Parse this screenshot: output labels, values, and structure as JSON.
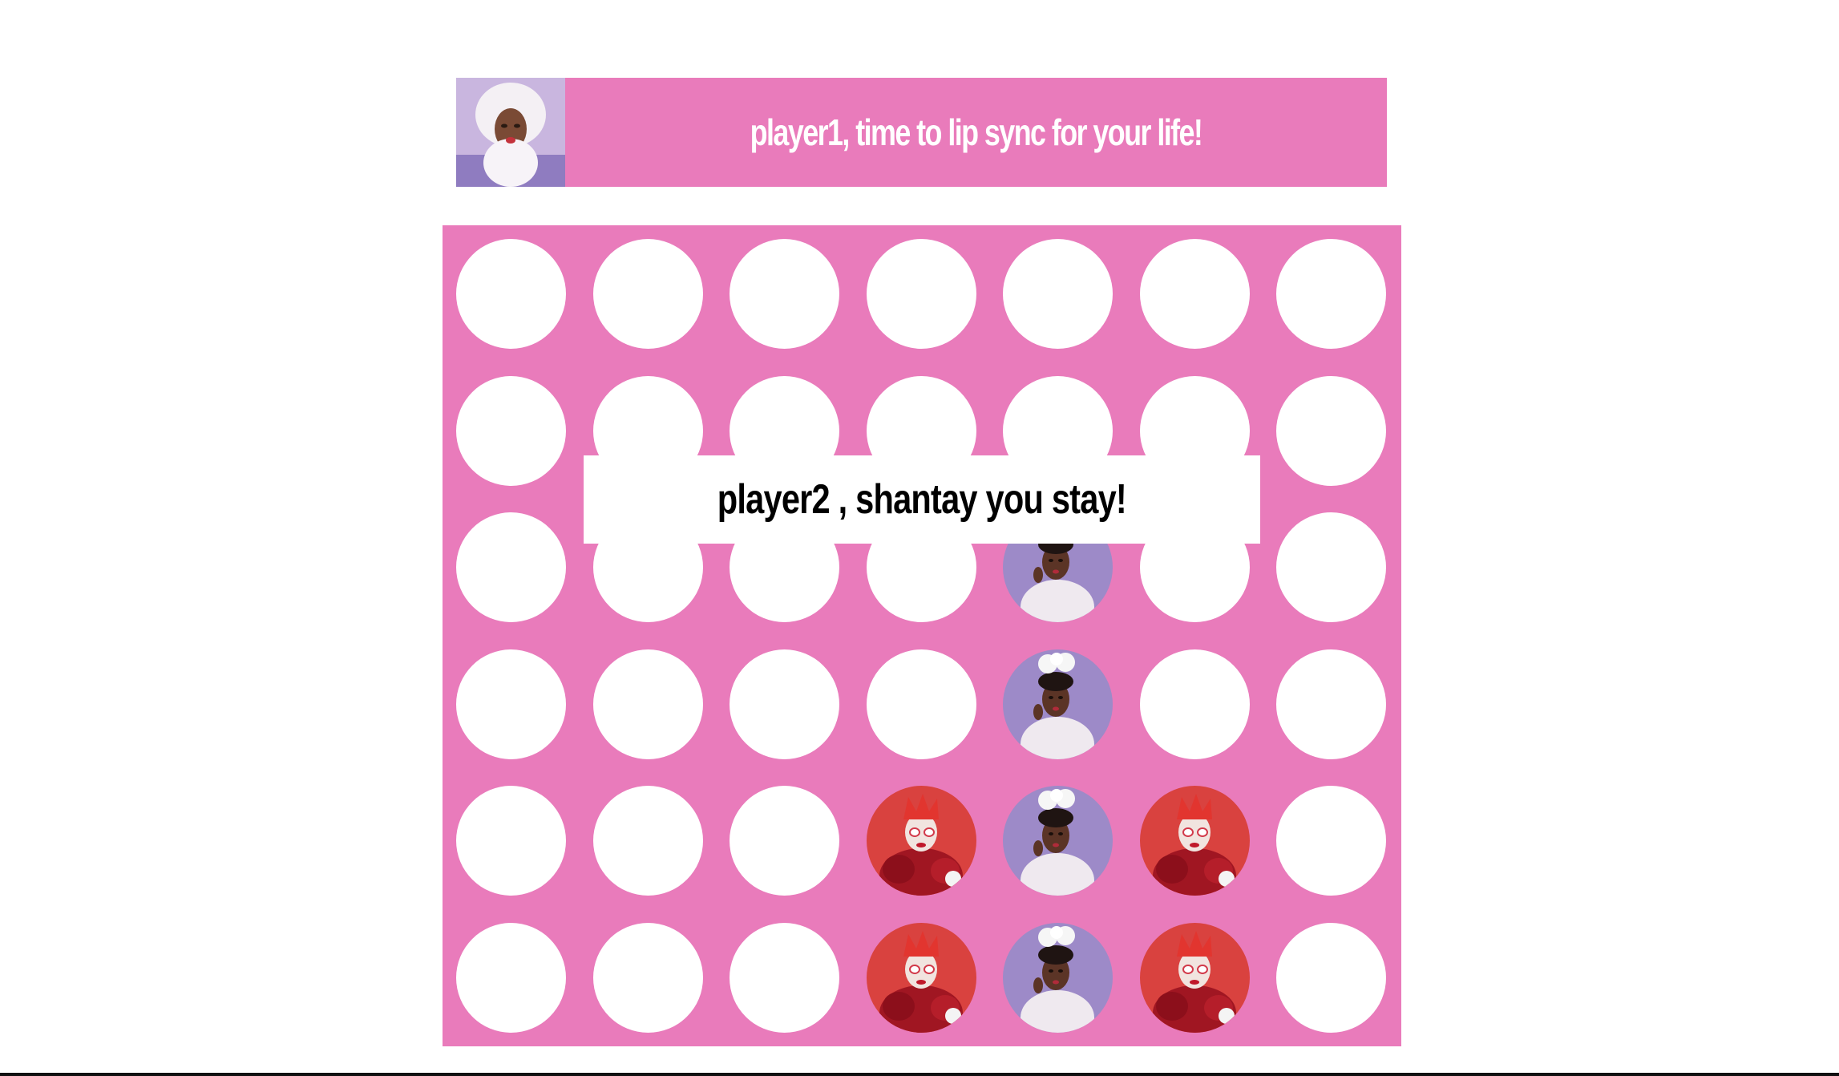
{
  "header": {
    "turn_message": "player1, time to lip sync for your life!",
    "avatar_icon": "player1-queen-avatar-icon"
  },
  "popup": {
    "message": "player2 , shantay you stay!"
  },
  "colors": {
    "board": "#e97bbb",
    "empty_slot": "#ffffff",
    "player1_token_bg": "#d9423f",
    "player2_token_bg": "#9d8ac8"
  },
  "board": {
    "rows": 6,
    "cols": 7,
    "cells": [
      [
        "empty",
        "empty",
        "empty",
        "empty",
        "empty",
        "empty",
        "empty"
      ],
      [
        "empty",
        "empty",
        "empty",
        "empty",
        "empty",
        "empty",
        "empty"
      ],
      [
        "empty",
        "empty",
        "empty",
        "empty",
        "player2",
        "empty",
        "empty"
      ],
      [
        "empty",
        "empty",
        "empty",
        "empty",
        "player2",
        "empty",
        "empty"
      ],
      [
        "empty",
        "empty",
        "empty",
        "player1",
        "player2",
        "player1",
        "empty"
      ],
      [
        "empty",
        "empty",
        "empty",
        "player1",
        "player2",
        "player1",
        "empty"
      ]
    ],
    "token_icons": {
      "player1": "red-queen-token-icon",
      "player2": "purple-queen-token-icon"
    }
  }
}
